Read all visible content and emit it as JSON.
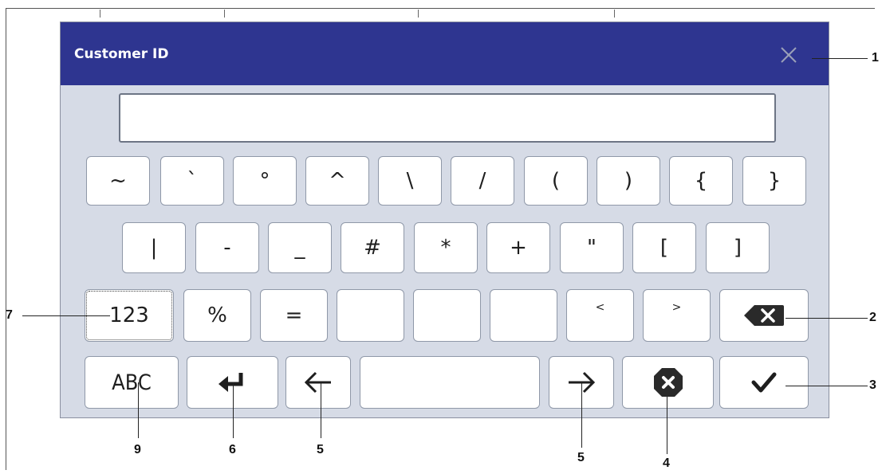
{
  "dialog": {
    "title": "Customer ID",
    "input_value": ""
  },
  "keyboard": {
    "row1": [
      "~",
      "`",
      "°",
      "^",
      "\\",
      "/",
      "(",
      ")",
      "{",
      "}"
    ],
    "row2": [
      "|",
      "-",
      "_",
      "#",
      "*",
      "+",
      "\"",
      "[",
      "]"
    ],
    "row3": [
      "123",
      "%",
      "=",
      "",
      "",
      "",
      "<",
      ">"
    ],
    "row4": {
      "abc": "ABC",
      "space": ""
    }
  },
  "icons": {
    "close": "close-icon",
    "backspace": "backspace-icon",
    "enter": "enter-icon",
    "left": "arrow-left-icon",
    "right": "arrow-right-icon",
    "clear": "clear-icon",
    "confirm": "checkmark-icon"
  },
  "callouts": [
    "1",
    "2",
    "3",
    "4",
    "5",
    "5",
    "6",
    "7",
    "9"
  ],
  "colors": {
    "titlebar": "#2e3590",
    "panel": "#d6dbe6",
    "key": "#ffffff"
  }
}
